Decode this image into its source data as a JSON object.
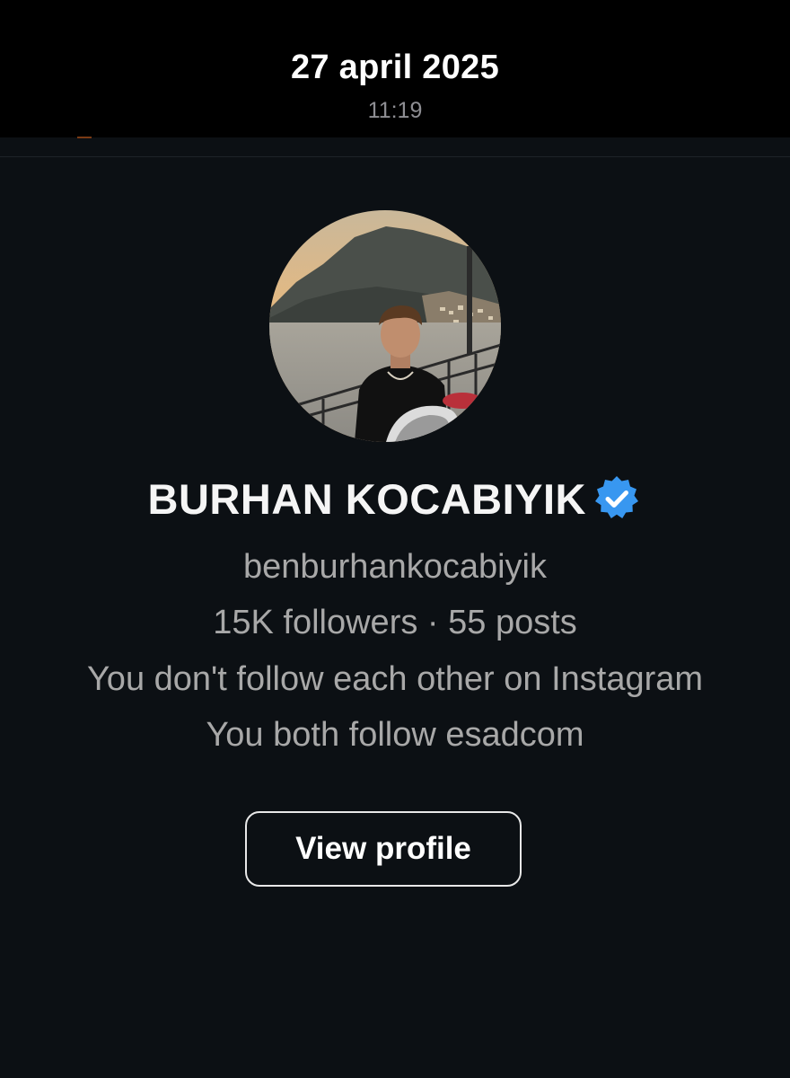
{
  "header": {
    "date": "27 april 2025",
    "time": "11:19"
  },
  "profile": {
    "avatar_icon": "profile-photo-man-seaside-cliffs",
    "name": "BURHAN KOCABIYIK",
    "verified": true,
    "verified_color": "#3897f0",
    "username": "benburhankocabiyik",
    "stats": "15K followers · 55 posts",
    "mutual_status": "You don't follow each other on Instagram",
    "mutual_follow": "You both follow esadcom"
  },
  "actions": {
    "view_profile_label": "View profile"
  },
  "colors": {
    "background": "#0c1014",
    "header_background": "#000000",
    "primary_text": "#f5f5f5",
    "secondary_text": "#a8a8a8"
  }
}
